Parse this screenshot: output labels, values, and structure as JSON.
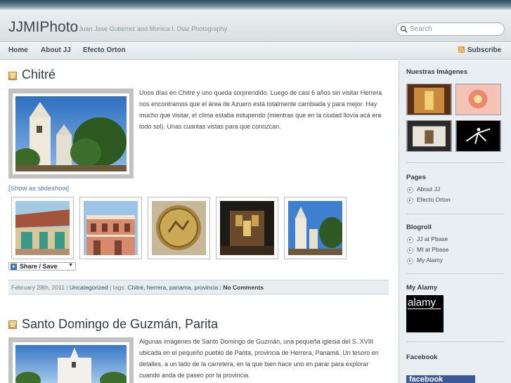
{
  "header": {
    "title": "JJMIPhoto",
    "tagline": "Juan Jose Gutierrez and Monica I. Diaz Photography",
    "search_placeholder": "Search"
  },
  "nav": {
    "items": [
      "Home",
      "About JJ",
      "Efecto Orton"
    ],
    "subscribe": "Subscribe"
  },
  "posts": [
    {
      "title": "Chitré",
      "body": "Unos días en Chitré y uno queda sorprendido.  Luego de casi 6 años sin visitar Herrera nos encontramos que el área de Azuero está totalmente cambiada y para mejor.  Hay mucho que visitar, el clima estaba estupendo (mientras que en la ciudad llovía acá era todo sol).  Unas cuantas vistas para que conozcan.",
      "slideshow": "[Show as slideshow]",
      "share": "Share / Save",
      "meta": {
        "date": "February 28th, 2011 | ",
        "category": "Uncategorized",
        "tags_prefix": " | tags: ",
        "tags": "Chitré, herrera, panama, provincia",
        "sep": " | ",
        "comments": "No Comments"
      }
    },
    {
      "title": "Santo Domingo de Guzmán, Parita",
      "body": "Algunas imágenes de Santo Domingo de Guzmán, una pequeña iglesia del S. XVIII ubicada en el pequeño pueblo de Parita, provincia de Herrera, Panamá. Un tesoro en detalles, a un lado de la carretera, en la que bien hace uno en parar para explorar cuando anda de paseo por la provincia."
    }
  ],
  "sidebar": {
    "images_title": "Nuestras Imágenes",
    "pages_title": "Pages",
    "pages": [
      "About JJ",
      "Efecto Orton"
    ],
    "blogroll_title": "Blogroll",
    "blogroll": [
      "JJ at Pbase",
      "MI at Pbase",
      "My Alamy"
    ],
    "alamy_title": "My Alamy",
    "alamy_logo": "alamy",
    "facebook_title": "Facebook",
    "facebook_logo": "facebook"
  },
  "colors": {
    "accent": "#2e3b42",
    "link": "#4f79a8",
    "sidebar_bg": "#e8eef1"
  }
}
